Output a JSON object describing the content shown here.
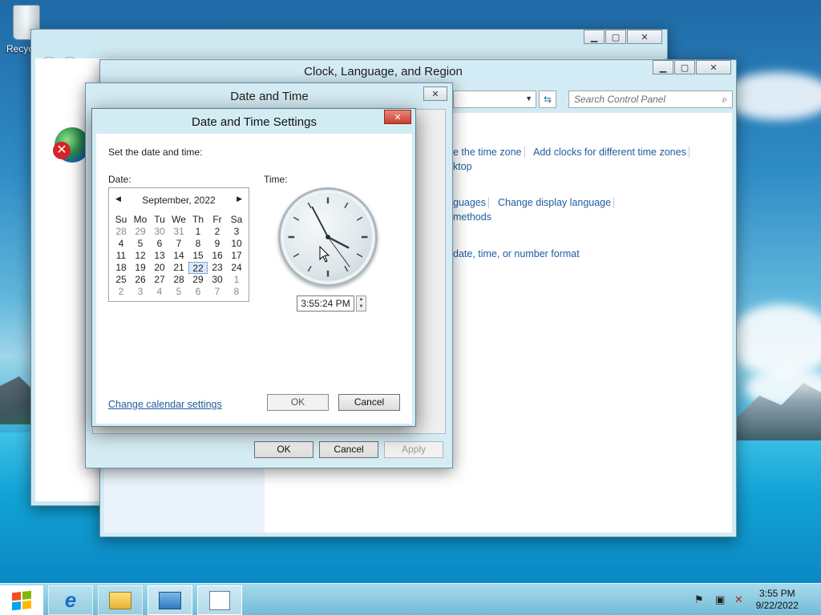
{
  "desktop": {
    "recycle_bin_label": "Recycle Bin"
  },
  "control_panel": {
    "window_title": "Clock, Language, and Region",
    "search_placeholder": "Search Control Panel",
    "links": {
      "time_zone": "e the time zone",
      "add_clocks": "Add clocks for different time zones",
      "desktop": "ktop",
      "languages": "guages",
      "change_display_language": "Change display language",
      "input_methods": "methods",
      "number_format": "date, time, or number format"
    }
  },
  "date_time_window": {
    "title": "Date and Time",
    "ok_label": "OK",
    "cancel_label": "Cancel",
    "apply_label": "Apply"
  },
  "settings_dialog": {
    "title": "Date and Time Settings",
    "instruction": "Set the date and time:",
    "date_label": "Date:",
    "time_label": "Time:",
    "calendar": {
      "month_year": "September, 2022",
      "weekdays": [
        "Su",
        "Mo",
        "Tu",
        "We",
        "Th",
        "Fr",
        "Sa"
      ],
      "weeks": [
        [
          "28",
          "29",
          "30",
          "31",
          "1",
          "2",
          "3"
        ],
        [
          "4",
          "5",
          "6",
          "7",
          "8",
          "9",
          "10"
        ],
        [
          "11",
          "12",
          "13",
          "14",
          "15",
          "16",
          "17"
        ],
        [
          "18",
          "19",
          "20",
          "21",
          "22",
          "23",
          "24"
        ],
        [
          "25",
          "26",
          "27",
          "28",
          "29",
          "30",
          "1"
        ],
        [
          "2",
          "3",
          "4",
          "5",
          "6",
          "7",
          "8"
        ]
      ],
      "selected_day": "22"
    },
    "clock": {
      "hours": 3,
      "minutes": 55,
      "seconds": 24
    },
    "time_value": "3:55:24 PM",
    "change_calendar_link": "Change calendar settings",
    "ok_label": "OK",
    "cancel_label": "Cancel"
  },
  "taskbar": {
    "clock_time": "3:55 PM",
    "clock_date": "9/22/2022"
  },
  "icons": {
    "accent": "#1f5c9e",
    "close_red": "#c7402f"
  }
}
